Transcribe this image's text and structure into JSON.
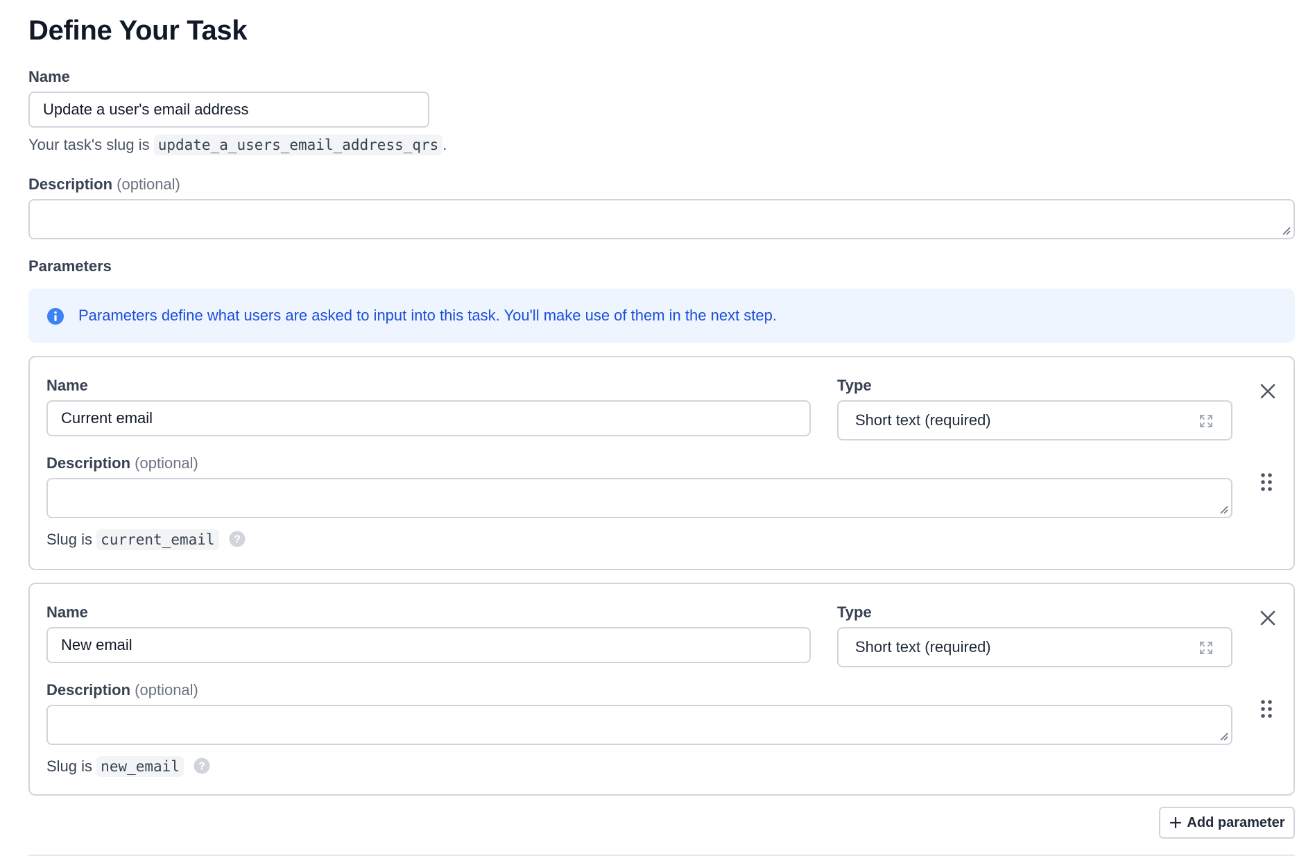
{
  "page": {
    "title": "Define Your Task"
  },
  "task": {
    "name_label": "Name",
    "name_value": "Update a user's email address",
    "slug_prefix": "Your task's slug is",
    "slug_value": "update_a_users_email_address_qrs",
    "slug_suffix": ".",
    "description_label": "Description",
    "optional_text": "(optional)",
    "description_value": ""
  },
  "parameters": {
    "label": "Parameters",
    "callout": {
      "icon": "info-icon",
      "text": "Parameters define what users are asked to input into this task. You'll make use of them in the next step."
    },
    "items": [
      {
        "name_label": "Name",
        "name_value": "Current email",
        "type_label": "Type",
        "type_value": "Short text (required)",
        "description_label": "Description",
        "optional_text": "(optional)",
        "description_value": "",
        "slug_prefix": "Slug is",
        "slug_value": "current_email"
      },
      {
        "name_label": "Name",
        "name_value": "New email",
        "type_label": "Type",
        "type_value": "Short text (required)",
        "description_label": "Description",
        "optional_text": "(optional)",
        "description_value": "",
        "slug_prefix": "Slug is",
        "slug_value": "new_email"
      }
    ],
    "add_button_label": "Add parameter"
  },
  "colors": {
    "accent_blue": "#1d4ed8",
    "callout_bg": "#eef5ff",
    "border": "#d1d5db"
  }
}
